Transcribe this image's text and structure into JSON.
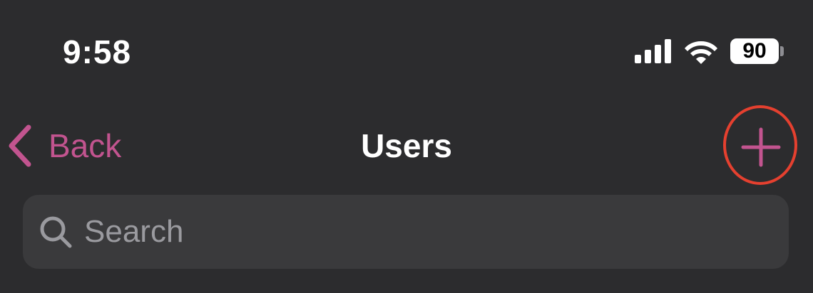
{
  "status_bar": {
    "time": "9:58",
    "battery_level": "90",
    "signal_icon": "cellular-signal-icon",
    "wifi_icon": "wifi-icon",
    "battery_icon": "battery-icon"
  },
  "nav": {
    "back_label": "Back",
    "back_icon": "chevron-left-icon",
    "title": "Users",
    "add_icon": "plus-icon"
  },
  "search": {
    "placeholder": "Search",
    "value": "",
    "icon": "search-icon"
  },
  "colors": {
    "background": "#2c2c2e",
    "accent": "#c2548f",
    "highlight_circle": "#e5402f",
    "search_field": "#3a3a3c",
    "placeholder": "#9a9a9f"
  }
}
